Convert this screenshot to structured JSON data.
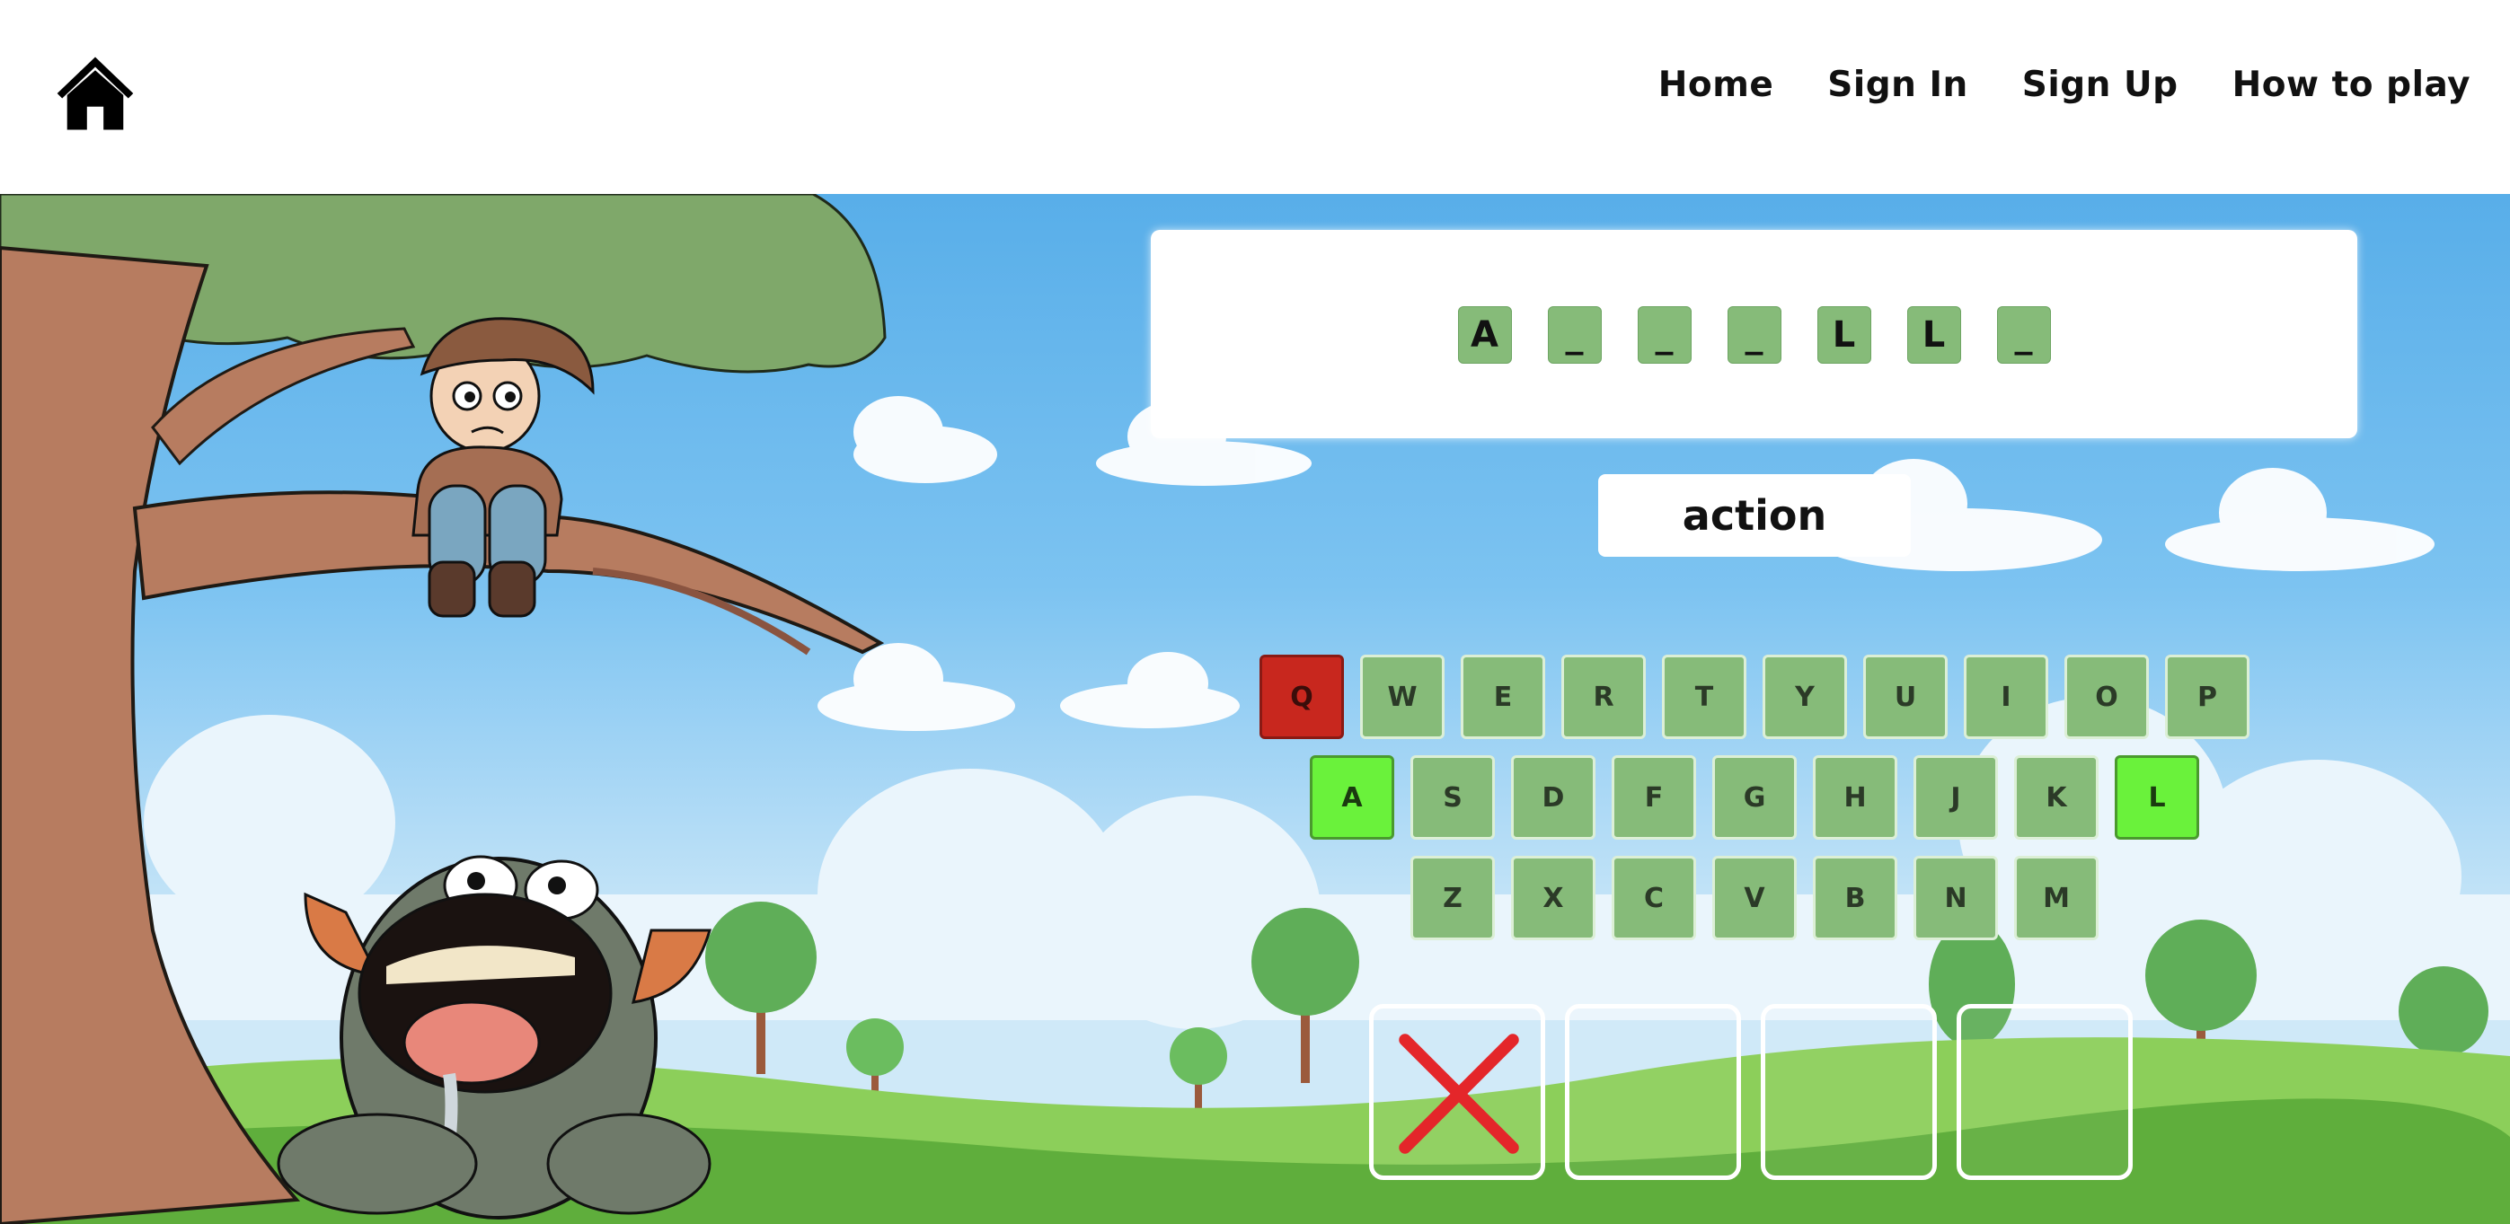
{
  "nav": {
    "home_icon": "house-icon",
    "links": [
      "Home",
      "Sign In",
      "Sign Up",
      "How to play"
    ]
  },
  "puzzle": {
    "letters": [
      "A",
      "_",
      "_",
      "_",
      "L",
      "L",
      "_"
    ],
    "hint": "action"
  },
  "keyboard": {
    "rows": [
      [
        "Q",
        "W",
        "E",
        "R",
        "T",
        "Y",
        "U",
        "I",
        "O",
        "P"
      ],
      [
        "A",
        "S",
        "D",
        "F",
        "G",
        "H",
        "J",
        "K",
        "L"
      ],
      [
        "Z",
        "X",
        "C",
        "V",
        "B",
        "N",
        "M"
      ]
    ],
    "wrong_letters": [
      "Q"
    ],
    "correct_letters": [
      "A",
      "L"
    ]
  },
  "lives": {
    "total": 4,
    "lost": 1,
    "lost_icon": "red-x-icon"
  },
  "colors": {
    "tile": "#86bb79",
    "wrong_key": "#c8271e",
    "correct_key": "#6af23b",
    "sky": "#58aee9"
  }
}
